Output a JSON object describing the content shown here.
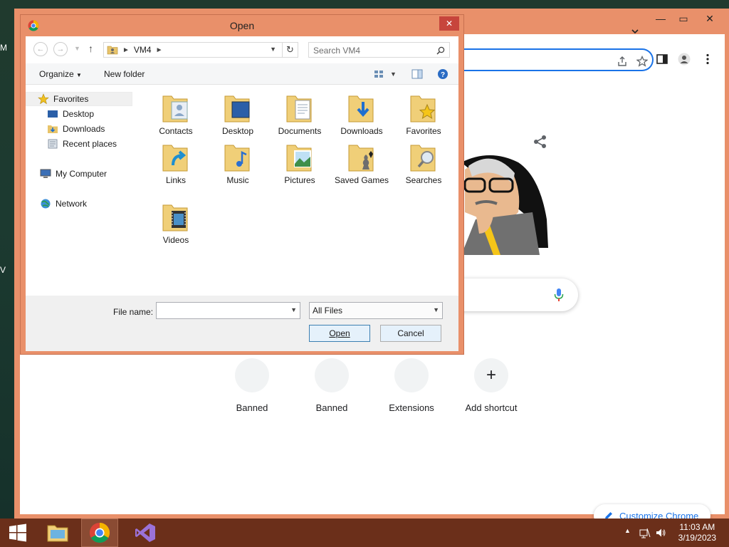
{
  "desktop": {
    "peek_top": "M",
    "peek_mid": "V"
  },
  "chrome": {
    "shortcuts": [
      {
        "label": "Banned"
      },
      {
        "label": "Banned"
      },
      {
        "label": "Extensions"
      },
      {
        "label": "Add shortcut",
        "icon": "+"
      }
    ],
    "customize_label": "Customize Chrome"
  },
  "dialog": {
    "title": "Open",
    "address_path": "VM4",
    "search_placeholder": "Search VM4",
    "commands": {
      "organize": "Organize",
      "new_folder": "New folder"
    },
    "nav": {
      "favorites": "Favorites",
      "desktop": "Desktop",
      "downloads": "Downloads",
      "recent": "Recent places",
      "computer": "My Computer",
      "network": "Network"
    },
    "folders": [
      {
        "label": "Contacts"
      },
      {
        "label": "Desktop"
      },
      {
        "label": "Documents"
      },
      {
        "label": "Downloads"
      },
      {
        "label": "Favorites"
      },
      {
        "label": "Links"
      },
      {
        "label": "Music"
      },
      {
        "label": "Pictures"
      },
      {
        "label": "Saved Games"
      },
      {
        "label": "Searches"
      },
      {
        "label": "Videos"
      }
    ],
    "file_name_label": "File name:",
    "file_name_value": "",
    "file_type": "All Files",
    "open_label": "Open",
    "cancel_label": "Cancel"
  },
  "taskbar": {
    "time": "11:03 AM",
    "date": "3/19/2023"
  }
}
